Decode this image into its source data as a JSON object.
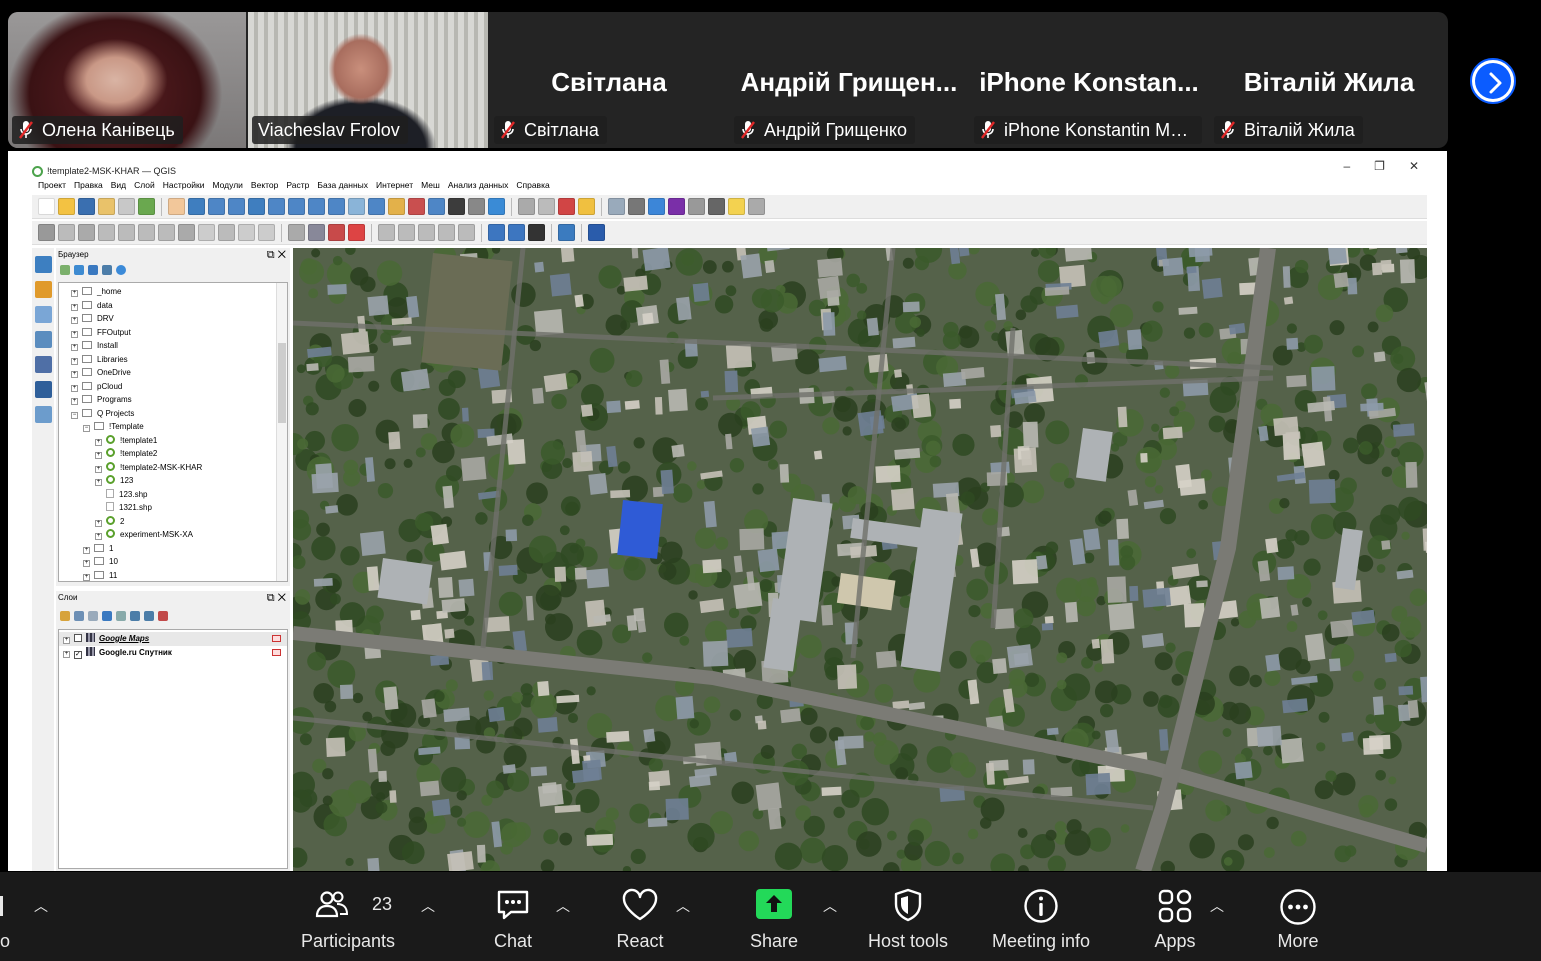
{
  "participants": [
    {
      "type": "video",
      "label": "Олена Канівець",
      "active": false
    },
    {
      "type": "video",
      "label": "Viacheslav Frolov",
      "active": true
    },
    {
      "type": "name",
      "big_name": "Світлана",
      "label": "Світлана"
    },
    {
      "type": "name",
      "big_name": "Андрій  Грищен...",
      "label": "Андрій Грищенко"
    },
    {
      "type": "name",
      "big_name": "iPhone  Konstan...",
      "label": "iPhone Konstantin Ma..."
    },
    {
      "type": "name",
      "big_name": "Віталій Жила",
      "label": "Віталій Жила"
    }
  ],
  "colors": {
    "active_speaker": "#23d959",
    "mic_muted": "#e02828",
    "accent": "#0b5cff",
    "share_green": "#23d959"
  },
  "qgis": {
    "title": "!template2-MSK-KHAR — QGIS",
    "menu": [
      "Проект",
      "Правка",
      "Вид",
      "Слой",
      "Настройки",
      "Модули",
      "Вектор",
      "Растр",
      "База данных",
      "Интернет",
      "Меш",
      "Анализ данных",
      "Справка"
    ],
    "browser_title": "Браузер",
    "browser_items": [
      {
        "label": "_home",
        "kind": "folder",
        "level": 1
      },
      {
        "label": "data",
        "kind": "folder",
        "level": 1
      },
      {
        "label": "DRV",
        "kind": "folder",
        "level": 1
      },
      {
        "label": "FFOutput",
        "kind": "folder",
        "level": 1
      },
      {
        "label": "Install",
        "kind": "folder",
        "level": 1
      },
      {
        "label": "Libraries",
        "kind": "folder",
        "level": 1
      },
      {
        "label": "OneDrive",
        "kind": "folder",
        "level": 1
      },
      {
        "label": "pCloud",
        "kind": "folder",
        "level": 1
      },
      {
        "label": "Programs",
        "kind": "folder",
        "level": 1
      },
      {
        "label": "Q Projects",
        "kind": "folder",
        "level": 1
      },
      {
        "label": "!Template",
        "kind": "folder",
        "level": 2
      },
      {
        "label": "!template1",
        "kind": "qgis",
        "level": 3
      },
      {
        "label": "!template2",
        "kind": "qgis",
        "level": 3
      },
      {
        "label": "!template2-MSK-KHAR",
        "kind": "qgis",
        "level": 3
      },
      {
        "label": "123",
        "kind": "qgis",
        "level": 3
      },
      {
        "label": "123.shp",
        "kind": "shp",
        "level": 3
      },
      {
        "label": "1321.shp",
        "kind": "shp",
        "level": 3
      },
      {
        "label": "2",
        "kind": "qgis",
        "level": 3
      },
      {
        "label": "experiment-MSK-XA",
        "kind": "qgis",
        "level": 3
      },
      {
        "label": "1",
        "kind": "folder",
        "level": 2
      },
      {
        "label": "10",
        "kind": "folder",
        "level": 2
      },
      {
        "label": "11",
        "kind": "folder",
        "level": 2
      }
    ],
    "layers_title": "Слои",
    "layers": [
      {
        "label": "Google Maps",
        "checked": false
      },
      {
        "label": "Google.ru Спутник",
        "checked": true
      }
    ]
  },
  "bottom_bar": {
    "participants_count": "23",
    "buttons": [
      "Participants",
      "Chat",
      "React",
      "Share",
      "Host tools",
      "Meeting info",
      "Apps",
      "More"
    ],
    "left_partial": "o"
  }
}
